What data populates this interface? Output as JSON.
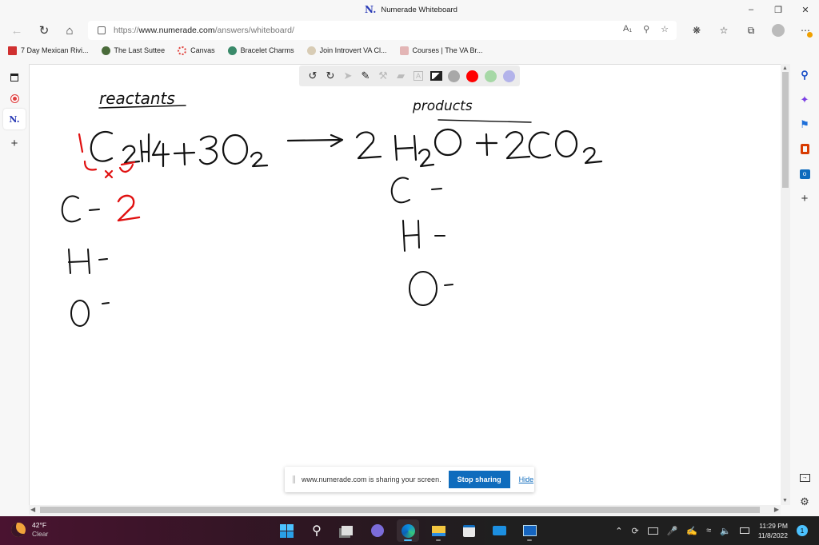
{
  "window": {
    "title": "Numerade Whiteboard",
    "logo": "N.",
    "controls": [
      "minimize",
      "restore",
      "close"
    ]
  },
  "navbar": {
    "url_prefix": "https://",
    "url_domain": "www.numerade.com",
    "url_path": "/answers/whiteboard/",
    "icons": [
      "back-icon",
      "refresh-icon",
      "home-icon",
      "lock-icon",
      "read-aloud-icon",
      "zoom-out-icon",
      "add-favorite-icon",
      "extensions-icon",
      "favorites-icon",
      "collections-icon",
      "profile-icon",
      "more-icon"
    ]
  },
  "bookmarks": [
    {
      "label": "7 Day Mexican Rivi...",
      "color": "#d03030"
    },
    {
      "label": "The Last Suttee",
      "color": "#4a6b3a"
    },
    {
      "label": "Canvas",
      "color": "#e0403a"
    },
    {
      "label": "Bracelet Charms",
      "color": "#3a8a6a"
    },
    {
      "label": "Join Introvert VA Cl...",
      "color": "#c8b89a"
    },
    {
      "label": "Courses | The VA Br...",
      "color": "#e3b5b5"
    }
  ],
  "left_rail": {
    "items": [
      "tab-actions-icon",
      "record-icon",
      "numerade-tab",
      "new-tab-icon"
    ],
    "numerade_label": "N."
  },
  "right_rail": {
    "items": [
      "search-icon",
      "copilot-icon",
      "shopping-icon",
      "office-icon",
      "outlook-icon",
      "add-icon"
    ]
  },
  "whiteboard_toolbar": {
    "tools": [
      "undo",
      "redo",
      "select",
      "pen",
      "tools",
      "eraser",
      "text",
      "image"
    ],
    "colors": [
      "#a8a8a8",
      "#ff0000",
      "#a6d8a6",
      "#b3b3ea"
    ],
    "selected_color": "#ff0000"
  },
  "whiteboard": {
    "label_reactants": "reactants",
    "label_products": "products",
    "equation": "1 C2H4 + 3O2 → 2 H2O + 2 CO2",
    "reactant_counts": [
      {
        "element": "C",
        "count": "2"
      },
      {
        "element": "H",
        "count": ""
      },
      {
        "element": "O",
        "count": ""
      }
    ],
    "product_counts": [
      {
        "element": "C",
        "count": ""
      },
      {
        "element": "H",
        "count": ""
      },
      {
        "element": "O",
        "count": ""
      }
    ],
    "annotation": "1 ... x"
  },
  "share_bar": {
    "message": "www.numerade.com is sharing your screen.",
    "stop_label": "Stop sharing",
    "hide_label": "Hide"
  },
  "taskbar": {
    "weather_temp": "42°F",
    "weather_desc": "Clear",
    "apps": [
      "start",
      "search",
      "task-view",
      "teams-chat",
      "edge",
      "file-explorer",
      "store",
      "mail",
      "whiteboard"
    ],
    "time": "11:29 PM",
    "date": "11/8/2022",
    "notification_count": "1"
  }
}
